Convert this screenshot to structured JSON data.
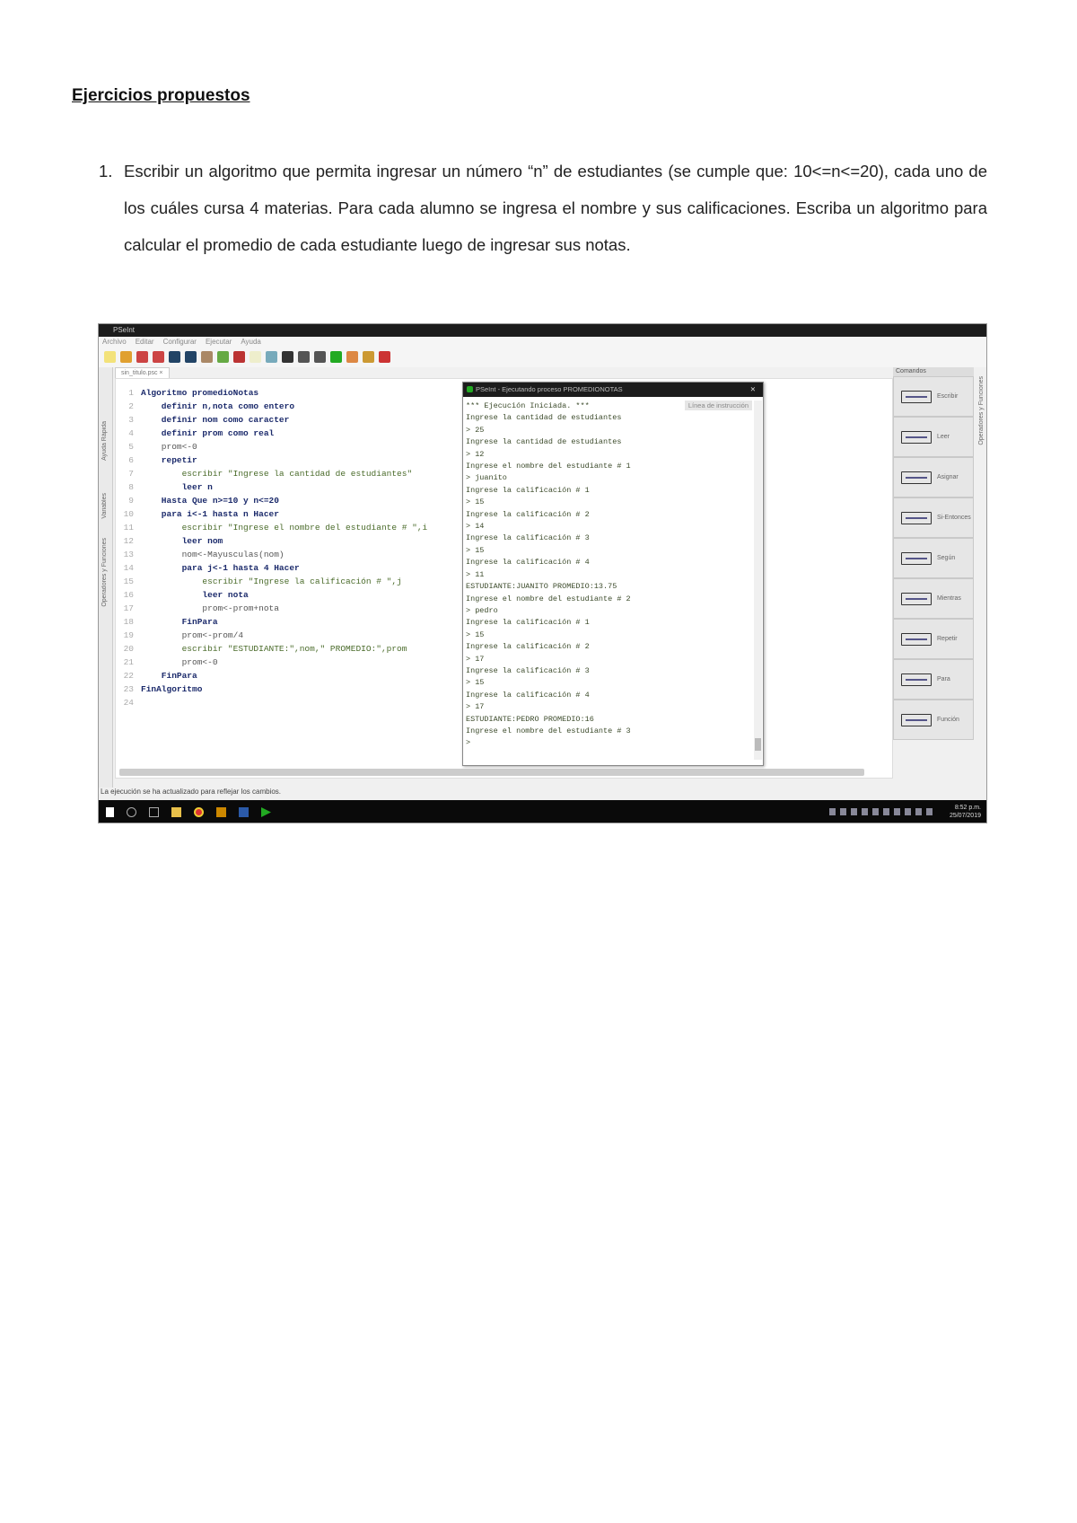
{
  "document": {
    "title": "Ejercicios propuestos",
    "item_number": "1.",
    "item_text": "Escribir un algoritmo que permita ingresar un número “n” de estudiantes (se cumple que: 10<=n<=20), cada uno de los cuáles cursa 4 materias. Para cada alumno se ingresa el nombre y sus calificaciones. Escriba un algoritmo para calcular el promedio de cada estudiante luego de ingresar sus notas."
  },
  "app": {
    "window_title": "PSeInt",
    "menu": [
      "Archivo",
      "Editar",
      "Configurar",
      "Ejecutar",
      "Ayuda"
    ],
    "tab": "sin_titulo.psc ×",
    "left_labels": [
      "Ayuda Rápida",
      "Variables",
      "Operadores y Funciones"
    ],
    "right_label": "Operadores y Funciones",
    "code": [
      {
        "n": "1",
        "t": "Algoritmo promedioNotas",
        "k": true
      },
      {
        "n": "2",
        "t": "    definir n,nota como entero",
        "k": true
      },
      {
        "n": "3",
        "t": "    definir nom como caracter",
        "k": true
      },
      {
        "n": "4",
        "t": "    definir prom como real",
        "k": true
      },
      {
        "n": "5",
        "t": "    prom<-0",
        "k": false
      },
      {
        "n": "6",
        "t": "    repetir",
        "k": true
      },
      {
        "n": "7",
        "t": "        escribir \"Ingrese la cantidad de estudiantes\"",
        "k": false,
        "s": true
      },
      {
        "n": "8",
        "t": "        leer n",
        "k": true
      },
      {
        "n": "9",
        "t": "    Hasta Que n>=10 y n<=20",
        "k": true
      },
      {
        "n": "10",
        "t": "    para i<-1 hasta n Hacer",
        "k": true
      },
      {
        "n": "11",
        "t": "        escribir \"Ingrese el nombre del estudiante # \",i",
        "k": false,
        "s": true
      },
      {
        "n": "12",
        "t": "        leer nom",
        "k": true
      },
      {
        "n": "13",
        "t": "        nom<-Mayusculas(nom)",
        "k": false
      },
      {
        "n": "14",
        "t": "        para j<-1 hasta 4 Hacer",
        "k": true
      },
      {
        "n": "15",
        "t": "            escribir \"Ingrese la calificación # \",j",
        "k": false,
        "s": true
      },
      {
        "n": "16",
        "t": "            leer nota",
        "k": true
      },
      {
        "n": "17",
        "t": "            prom<-prom+nota",
        "k": false
      },
      {
        "n": "18",
        "t": "        FinPara",
        "k": true
      },
      {
        "n": "19",
        "t": "        prom<-prom/4",
        "k": false
      },
      {
        "n": "20",
        "t": "        escribir \"ESTUDIANTE:\",nom,\" PROMEDIO:\",prom",
        "k": false,
        "s": true
      },
      {
        "n": "21",
        "t": "        prom<-0",
        "k": false
      },
      {
        "n": "22",
        "t": "    FinPara",
        "k": true
      },
      {
        "n": "23",
        "t": "FinAlgoritmo",
        "k": true
      },
      {
        "n": "24",
        "t": "",
        "k": false
      }
    ],
    "console": {
      "title": "PSeInt - Ejecutando proceso PROMEDIONOTAS",
      "button": "Línea de instrucción",
      "lines": [
        "*** Ejecución Iniciada. ***",
        "Ingrese la cantidad de estudiantes",
        "> 25",
        "Ingrese la cantidad de estudiantes",
        "> 12",
        "Ingrese el nombre del estudiante # 1",
        "> juanito",
        "Ingrese la calificación # 1",
        "> 15",
        "Ingrese la calificación # 2",
        "> 14",
        "Ingrese la calificación # 3",
        "> 15",
        "Ingrese la calificación # 4",
        "> 11",
        "ESTUDIANTE:JUANITO PROMEDIO:13.75",
        "Ingrese el nombre del estudiante # 2",
        "> pedro",
        "Ingrese la calificación # 1",
        "> 15",
        "Ingrese la calificación # 2",
        "> 17",
        "Ingrese la calificación # 3",
        "> 15",
        "Ingrese la calificación # 4",
        "> 17",
        "ESTUDIANTE:PEDRO PROMEDIO:16",
        "Ingrese el nombre del estudiante # 3",
        ">"
      ]
    },
    "palette": {
      "header": "Comandos",
      "items": [
        "Escribir",
        "Leer",
        "Asignar",
        "Si-Entonces",
        "Según",
        "Mientras",
        "Repetir",
        "Para",
        "Función"
      ]
    },
    "status": "La ejecución se ha actualizado para reflejar los cambios.",
    "clock": {
      "time": "8:52 p.m.",
      "date": "25/07/2019"
    }
  }
}
